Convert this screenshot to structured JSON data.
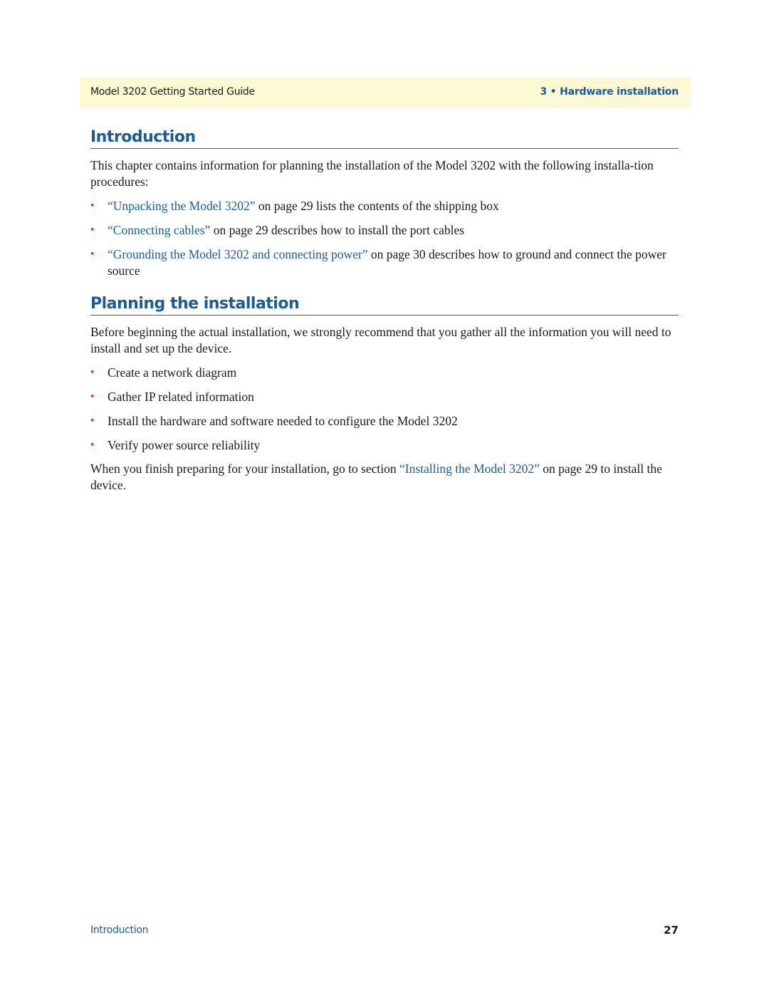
{
  "header": {
    "guide_title": "Model 3202 Getting Started Guide",
    "chapter": "3 • Hardware installation"
  },
  "introduction": {
    "heading": "Introduction",
    "paragraph": "This chapter contains information for planning the installation of the Model 3202 with the following installa-tion procedures:",
    "items": [
      {
        "link": "“Unpacking the Model 3202”",
        "text": " on page 29 lists the contents of the shipping box"
      },
      {
        "link": "“Connecting cables”",
        "text": " on page 29 describes how to install the port cables"
      },
      {
        "link": "“Grounding the Model 3202 and connecting power”",
        "text": " on page 30 describes how to ground and connect the power source"
      }
    ]
  },
  "planning": {
    "heading": "Planning the installation",
    "paragraph": "Before beginning the actual installation, we strongly recommend that you gather all the information you will need to install and set up the device.",
    "items": [
      "Create a network diagram",
      "Gather IP related information",
      "Install the hardware and software needed to configure the Model 3202",
      "Verify power source reliability"
    ],
    "closing_before": "When you finish preparing for your installation, go to section ",
    "closing_link": "“Installing the Model 3202”",
    "closing_after": " on page 29 to install the device."
  },
  "footer": {
    "section": "Introduction",
    "page_number": "27"
  },
  "bullet_glyph": "•"
}
